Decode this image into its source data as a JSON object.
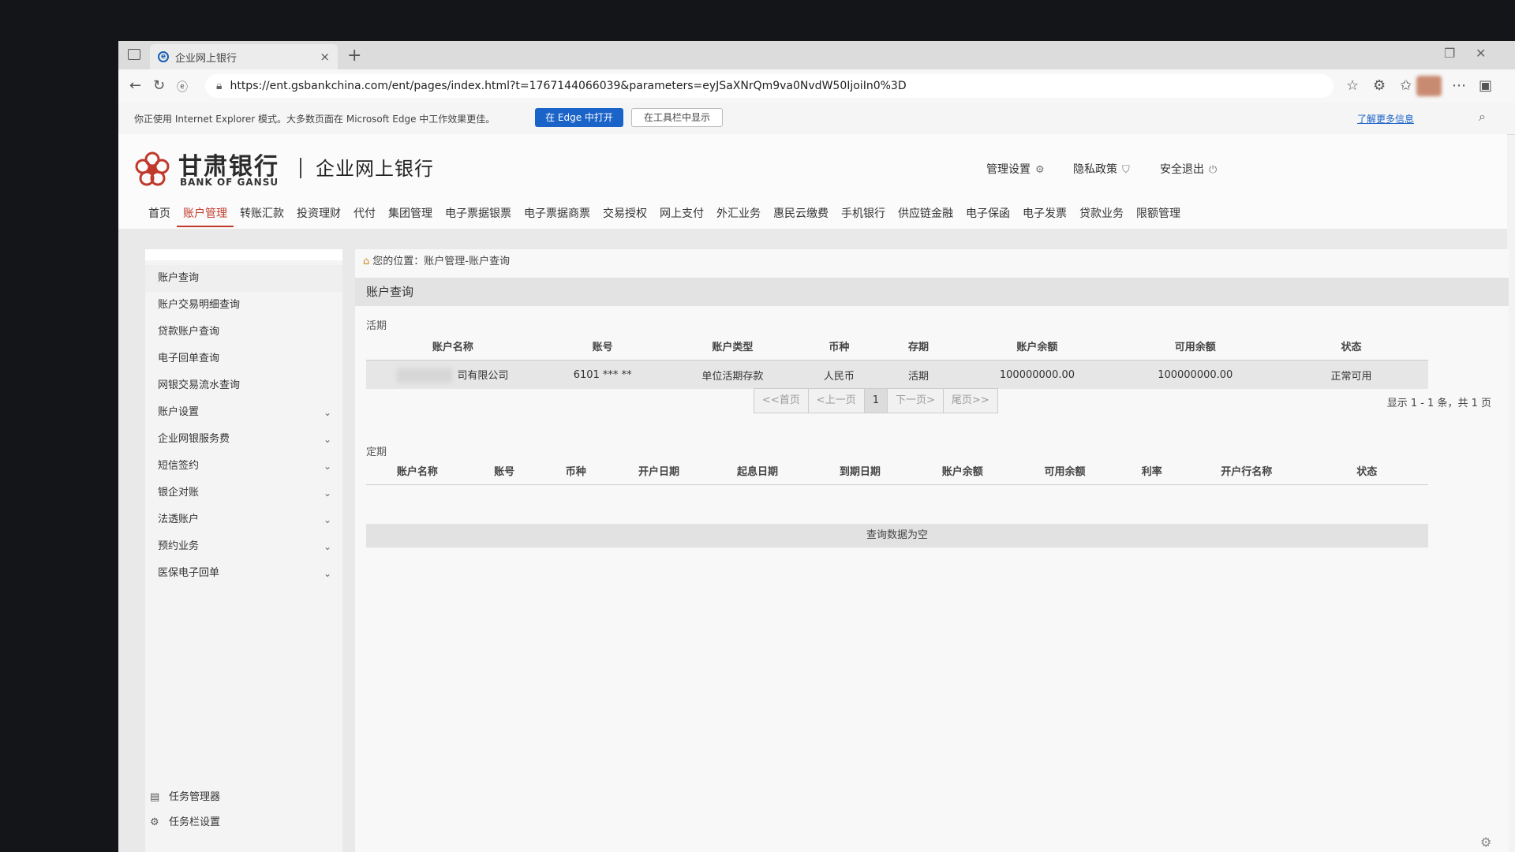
{
  "browser": {
    "tab_title": "企业网上银行",
    "tab_close": "×",
    "new_tab": "+",
    "url": "https://ent.gsbankchina.com/ent/pages/index.html?t=1767144066039&parameters=eyJSaXNrQm9va0NvdW50IjoiIn0%3D",
    "ie_mode_message": "你正使用 Internet Explorer 模式。大多数页面在 Microsoft Edge 中工作效果更佳。",
    "open_in_edge": "在 Edge 中打开",
    "show_in_toolbar": "在工具栏中显示",
    "learn_more": "了解更多信息"
  },
  "bank": {
    "name_cn": "甘肃银行",
    "name_en": "BANK OF GANSU",
    "subtitle": "企业网上银行",
    "links": {
      "manage_settings": "管理设置",
      "privacy_policy": "隐私政策",
      "safe_exit": "安全退出"
    },
    "nav": [
      "首页",
      "账户管理",
      "转账汇款",
      "投资理财",
      "代付",
      "集团管理",
      "电子票据银票",
      "电子票据商票",
      "交易授权",
      "网上支付",
      "外汇业务",
      "惠民云缴费",
      "手机银行",
      "供应链金融",
      "电子保函",
      "电子发票",
      "贷款业务",
      "限额管理"
    ]
  },
  "sidebar": {
    "items": [
      {
        "label": "账户查询",
        "expand": false
      },
      {
        "label": "账户交易明细查询",
        "expand": false
      },
      {
        "label": "贷款账户查询",
        "expand": false
      },
      {
        "label": "电子回单查询",
        "expand": false
      },
      {
        "label": "网银交易流水查询",
        "expand": false
      },
      {
        "label": "账户设置",
        "expand": true
      },
      {
        "label": "企业网银服务费",
        "expand": true
      },
      {
        "label": "短信签约",
        "expand": true
      },
      {
        "label": "银企对账",
        "expand": true
      },
      {
        "label": "法透账户",
        "expand": true
      },
      {
        "label": "预约业务",
        "expand": true
      },
      {
        "label": "医保电子回单",
        "expand": true
      }
    ],
    "taskbar": {
      "task_manager": "任务管理器",
      "taskbar_settings": "任务栏设置"
    }
  },
  "main": {
    "breadcrumb": "您的位置：账户管理-账户查询",
    "section_title": "账户查询",
    "current": {
      "label": "活期",
      "headers": [
        "账户名称",
        "账号",
        "账户类型",
        "币种",
        "存期",
        "账户余额",
        "可用余额",
        "状态"
      ],
      "rows": [
        {
          "name": "司有限公司",
          "account": "6101 *** **",
          "type": "单位活期存款",
          "currency": "人民币",
          "term": "活期",
          "balance": "100000000.00",
          "available": "100000000.00",
          "status": "正常可用"
        }
      ]
    },
    "pager": {
      "first": "<<首页",
      "prev": "<上一页",
      "page": "1",
      "next": "下一页>",
      "last": "尾页>>",
      "info": "显示 1 - 1 条，共 1 页"
    },
    "fixed": {
      "label": "定期",
      "headers": [
        "账户名称",
        "账号",
        "币种",
        "开户日期",
        "起息日期",
        "到期日期",
        "账户余额",
        "可用余额",
        "利率",
        "开户行名称",
        "状态"
      ],
      "empty": "查询数据为空"
    }
  }
}
